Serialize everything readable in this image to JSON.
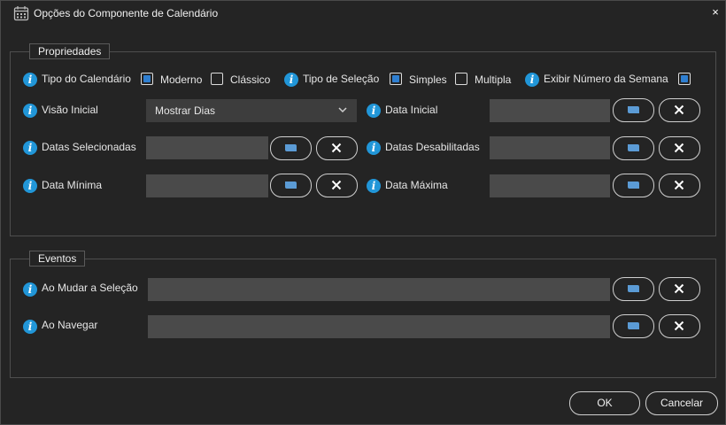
{
  "window": {
    "title": "Opções do Componente de Calendário",
    "icon": "calendar-icon",
    "close_glyph": "×"
  },
  "properties": {
    "legend": "Propriedades",
    "calendar_type": {
      "label": "Tipo do Calendário",
      "options": [
        {
          "label": "Moderno",
          "checked": true
        },
        {
          "label": "Clássico",
          "checked": false
        }
      ]
    },
    "selection_type": {
      "label": "Tipo de Seleção",
      "options": [
        {
          "label": "Simples",
          "checked": true
        },
        {
          "label": "Multipla",
          "checked": false
        }
      ]
    },
    "show_week_number": {
      "label": "Exibir Número da Semana",
      "checked": true
    },
    "initial_view": {
      "label": "Visão Inicial",
      "value": "Mostrar Dias"
    },
    "initial_date": {
      "label": "Data Inicial",
      "value": ""
    },
    "selected_dates": {
      "label": "Datas Selecionadas",
      "value": ""
    },
    "disabled_dates": {
      "label": "Datas Desabilitadas",
      "value": ""
    },
    "min_date": {
      "label": "Data Mínima",
      "value": ""
    },
    "max_date": {
      "label": "Data Máxima",
      "value": ""
    }
  },
  "events": {
    "legend": "Eventos",
    "on_selection_change": {
      "label": "Ao Mudar a Seleção",
      "value": ""
    },
    "on_navigate": {
      "label": "Ao Navegar",
      "value": ""
    }
  },
  "footer": {
    "ok_label": "OK",
    "cancel_label": "Cancelar"
  },
  "colors": {
    "background": "#242424",
    "field": "#4a4a4a",
    "accent": "#2f7fd1",
    "info": "#2196d8",
    "bind_icon": "#5b9bd5"
  },
  "icons": {
    "info": "info-icon",
    "bind": "script-icon",
    "clear": "clear-icon",
    "dropdown": "chevron-down-icon"
  },
  "info_glyph": "i"
}
